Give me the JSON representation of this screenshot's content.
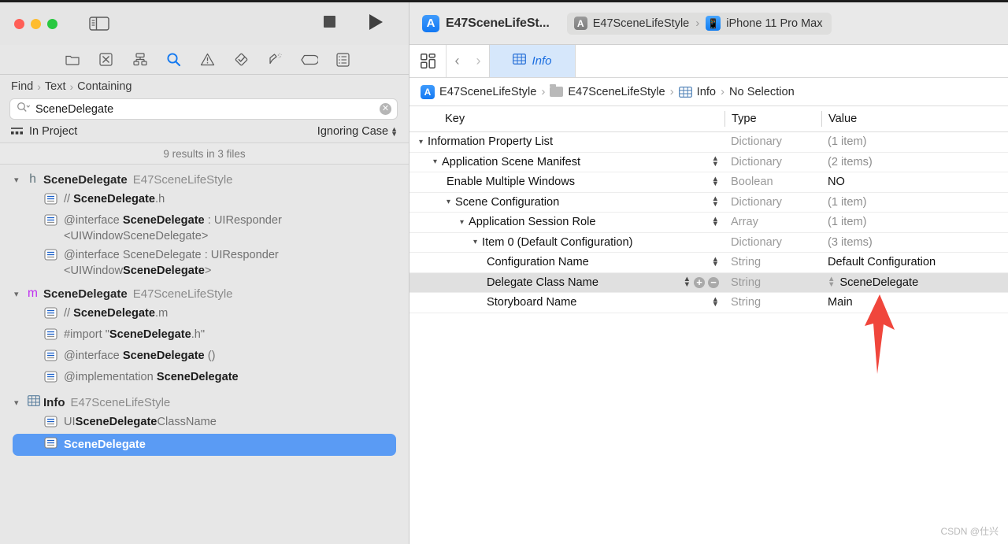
{
  "window": {
    "traffic_lights": [
      "close",
      "minimize",
      "zoom"
    ],
    "sidebar_toggle_icon": "sidebar-toggle-icon",
    "stop_icon": "stop-icon",
    "run_icon": "run-icon"
  },
  "toolbar": {
    "project_title": "E47SceneLifeSt...",
    "scheme_name": "E47SceneLifeStyle",
    "destination": "iPhone 11 Pro Max",
    "separator": "›"
  },
  "navigator": {
    "tabs": [
      {
        "name": "project-navigator",
        "icon": "folder-icon",
        "selected": false
      },
      {
        "name": "source-control-navigator",
        "icon": "source-control-icon",
        "selected": false
      },
      {
        "name": "symbol-navigator",
        "icon": "hierarchy-icon",
        "selected": false
      },
      {
        "name": "find-navigator",
        "icon": "search-icon",
        "selected": true
      },
      {
        "name": "issue-navigator",
        "icon": "warning-triangle-icon",
        "selected": false
      },
      {
        "name": "test-navigator",
        "icon": "diamond-check-icon",
        "selected": false
      },
      {
        "name": "debug-navigator",
        "icon": "debug-spray-icon",
        "selected": false
      },
      {
        "name": "breakpoint-navigator",
        "icon": "breakpoint-tag-icon",
        "selected": false
      },
      {
        "name": "report-navigator",
        "icon": "report-list-icon",
        "selected": false
      }
    ],
    "find_scope": {
      "mode": "Find",
      "kind": "Text",
      "match": "Containing",
      "separator": "›"
    },
    "search": {
      "value": "SceneDelegate",
      "placeholder": "Search",
      "clear_label": "✕"
    },
    "scope_row": {
      "scope": "In Project",
      "case_option": "Ignoring Case"
    },
    "results_summary": "9 results in 3 files",
    "groups": [
      {
        "file_type": "h",
        "file_name": "SceneDelegate",
        "project": "E47SceneLifeStyle",
        "expanded": true,
        "results": [
          {
            "segments": [
              {
                "t": "// ",
                "b": false
              },
              {
                "t": "SceneDelegate",
                "b": true
              },
              {
                "t": ".h",
                "b": false
              }
            ]
          },
          {
            "segments": [
              {
                "t": "@interface ",
                "b": false
              },
              {
                "t": "SceneDelegate",
                "b": true
              },
              {
                "t": " : UIResponder <UIWindowSceneDelegate>",
                "b": false
              }
            ]
          },
          {
            "segments": [
              {
                "t": "@interface SceneDelegate : UIResponder <UIWindow",
                "b": false
              },
              {
                "t": "SceneDelegate",
                "b": true
              },
              {
                "t": ">",
                "b": false
              }
            ]
          }
        ]
      },
      {
        "file_type": "m",
        "file_name": "SceneDelegate",
        "project": "E47SceneLifeStyle",
        "expanded": true,
        "results": [
          {
            "segments": [
              {
                "t": "// ",
                "b": false
              },
              {
                "t": "SceneDelegate",
                "b": true
              },
              {
                "t": ".m",
                "b": false
              }
            ]
          },
          {
            "segments": [
              {
                "t": "#import \"",
                "b": false
              },
              {
                "t": "SceneDelegate",
                "b": true
              },
              {
                "t": ".h\"",
                "b": false
              }
            ]
          },
          {
            "segments": [
              {
                "t": "@interface ",
                "b": false
              },
              {
                "t": "SceneDelegate",
                "b": true
              },
              {
                "t": " ()",
                "b": false
              }
            ]
          },
          {
            "segments": [
              {
                "t": "@implementation ",
                "b": false
              },
              {
                "t": "SceneDelegate",
                "b": true
              }
            ]
          }
        ]
      },
      {
        "file_type": "plist",
        "file_name": "Info",
        "project": "E47SceneLifeStyle",
        "expanded": true,
        "results": [
          {
            "segments": [
              {
                "t": "UI",
                "b": false
              },
              {
                "t": "SceneDelegate",
                "b": true
              },
              {
                "t": "ClassName",
                "b": false
              }
            ]
          },
          {
            "selected": true,
            "segments": [
              {
                "t": "SceneDelegate",
                "b": true
              }
            ]
          }
        ]
      }
    ]
  },
  "editor": {
    "jumpbar": {
      "related_items_icon": "related-items-icon",
      "back_arrow": "‹",
      "forward_arrow": "›",
      "tab_label": "Info",
      "tab_icon": "plist-table-icon"
    },
    "breadcrumb": [
      {
        "label": "E47SceneLifeStyle",
        "icon": "app-project-icon"
      },
      {
        "label": "E47SceneLifeStyle",
        "icon": "folder-icon"
      },
      {
        "label": "Info",
        "icon": "plist-table-icon"
      },
      {
        "label": "No Selection",
        "icon": null
      }
    ],
    "breadcrumb_separator": "›",
    "plist": {
      "columns": [
        "Key",
        "Type",
        "Value"
      ],
      "rows": [
        {
          "indent": 0,
          "disclosure": "open",
          "key": "Information Property List",
          "stepper": false,
          "type": "Dictionary",
          "value": "(1 item)",
          "value_muted": true,
          "highlight": false,
          "value_stepper": false,
          "addremove": false
        },
        {
          "indent": 1,
          "disclosure": "open",
          "key": "Application Scene Manifest",
          "stepper": true,
          "type": "Dictionary",
          "value": "(2 items)",
          "value_muted": true,
          "highlight": false,
          "value_stepper": false,
          "addremove": false
        },
        {
          "indent": 2,
          "disclosure": "none",
          "key": "Enable Multiple Windows",
          "stepper": true,
          "type": "Boolean",
          "value": "NO",
          "value_muted": false,
          "highlight": false,
          "value_stepper": false,
          "addremove": false
        },
        {
          "indent": 2,
          "disclosure": "open",
          "key": "Scene Configuration",
          "stepper": true,
          "type": "Dictionary",
          "value": "(1 item)",
          "value_muted": true,
          "highlight": false,
          "value_stepper": false,
          "addremove": false
        },
        {
          "indent": 3,
          "disclosure": "open",
          "key": "Application Session Role",
          "stepper": true,
          "type": "Array",
          "value": "(1 item)",
          "value_muted": true,
          "highlight": false,
          "value_stepper": false,
          "addremove": false
        },
        {
          "indent": 4,
          "disclosure": "open",
          "key": "Item 0 (Default Configuration)",
          "stepper": false,
          "type": "Dictionary",
          "value": "(3 items)",
          "value_muted": true,
          "highlight": false,
          "value_stepper": false,
          "addremove": false
        },
        {
          "indent": 5,
          "disclosure": "none",
          "key": "Configuration Name",
          "stepper": true,
          "type": "String",
          "value": "Default Configuration",
          "value_muted": false,
          "highlight": false,
          "value_stepper": false,
          "addremove": false
        },
        {
          "indent": 5,
          "disclosure": "none",
          "key": "Delegate Class Name",
          "stepper": true,
          "type": "String",
          "value": "SceneDelegate",
          "value_muted": false,
          "highlight": true,
          "value_stepper": true,
          "addremove": true
        },
        {
          "indent": 5,
          "disclosure": "none",
          "key": "Storyboard Name",
          "stepper": true,
          "type": "String",
          "value": "Main",
          "value_muted": false,
          "highlight": false,
          "value_stepper": false,
          "addremove": false
        }
      ],
      "add_label": "+",
      "remove_label": "−"
    }
  },
  "annotation": {
    "arrow_color": "#f0463c",
    "points_at": "Delegate Class Name value"
  },
  "watermark": "CSDN @仕兴"
}
